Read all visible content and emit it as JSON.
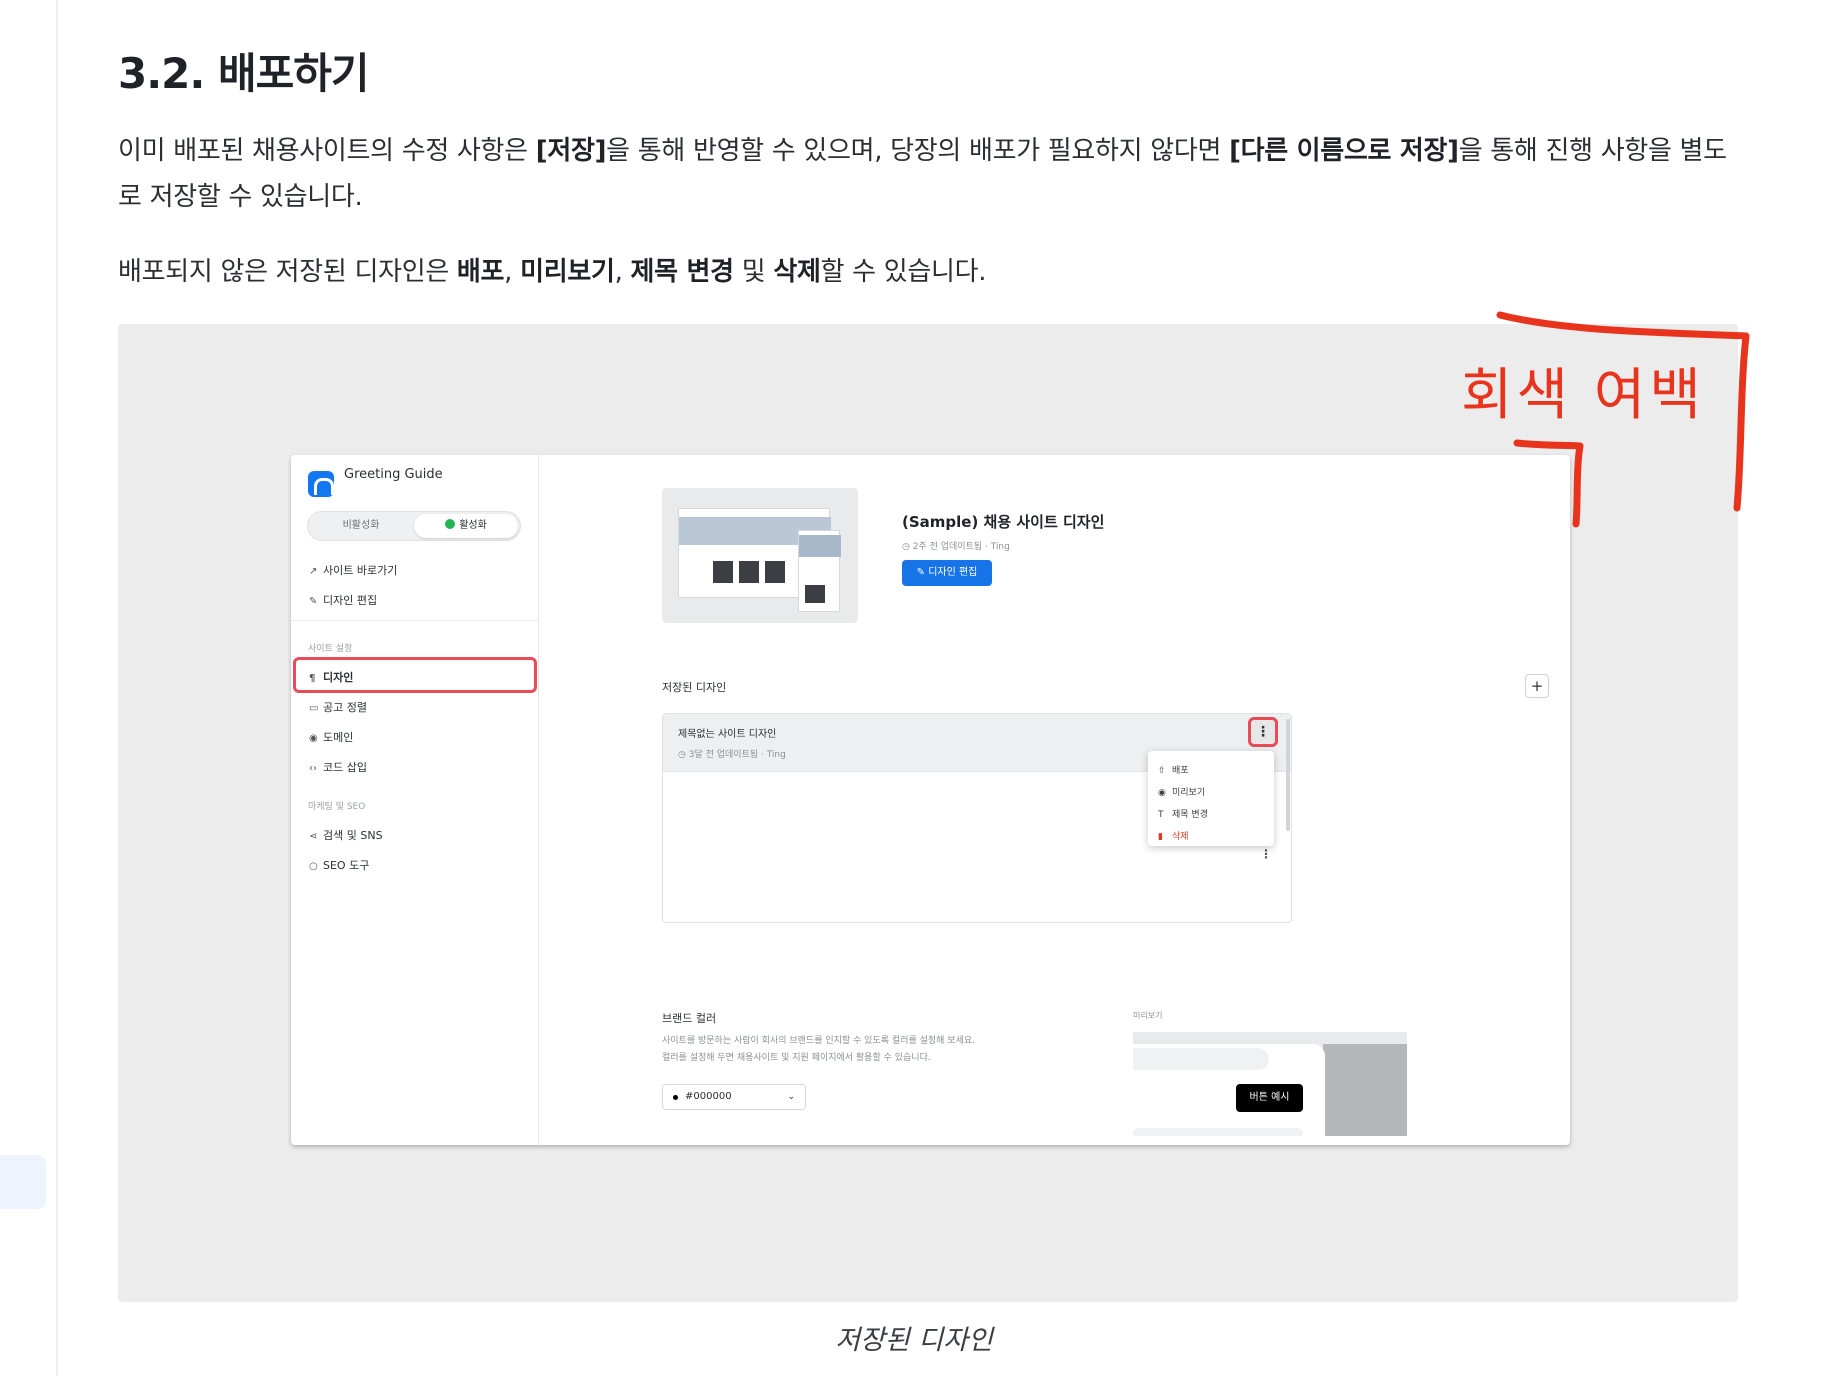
{
  "doc": {
    "heading": "3.2. 배포하기",
    "para1": {
      "t1": "이미 배포된 채용사이트의 수정 사항은 ",
      "b1": "[저장]",
      "t2": "을 통해 반영할 수 있으며, 당장의 배포가 필요하지 않다면 ",
      "b2": "[다른 이름으로 저장]",
      "t3": "을 통해 진행 사항을 별도로 저장할 수 있습니다."
    },
    "para2": {
      "t1": "배포되지 않은 저장된 디자인은 ",
      "b1": "배포",
      "t2": ", ",
      "b2": "미리보기",
      "t3": ", ",
      "b3": "제목 변경",
      "t4": " 및 ",
      "b4": "삭제",
      "t5": "할 수 있습니다."
    },
    "caption": "저장된 디자인",
    "annotation": "회색 여백",
    "annotation_color": "#e8341c"
  },
  "app": {
    "name": "Greeting Guide",
    "toggle_off": "비활성화",
    "toggle_on": "활성화",
    "nav_top": [
      "사이트 바로가기",
      "디자인 편집"
    ],
    "section1_label": "사이트 설정",
    "nav_site": [
      "디자인",
      "공고 정렬",
      "도메인",
      "코드 삽입"
    ],
    "section2_label": "마케팅 및 SEO",
    "nav_marketing": [
      "검색 및 SNS",
      "SEO 도구"
    ],
    "current_design": {
      "title": "(Sample) 채용 사이트 디자인",
      "meta": "2주 전 업데이트됨 · Ting",
      "edit_label": "디자인 편집"
    },
    "saved_label": "저장된 디자인",
    "plus": "+",
    "saved_row": {
      "title": "제목없는 사이트 디자인",
      "meta": "3달 전 업데이트됨 · Ting"
    },
    "menu": [
      "배포",
      "미리보기",
      "제목 변경",
      "삭제"
    ],
    "brand_label": "브랜드 컬러",
    "brand_desc1": "사이트를 방문하는 사람이 회사의 브랜드를 인지할 수 있도록 컬러를 설정해 보세요.",
    "brand_desc2": "컬러를 설정해 두면 채용사이트 및 지원 페이지에서 활용할 수 있습니다.",
    "brand_color": "#000000",
    "preview_label": "미리보기",
    "preview_button": "버튼 예시",
    "accent": "#1673e8",
    "highlight": "#e84c57"
  }
}
